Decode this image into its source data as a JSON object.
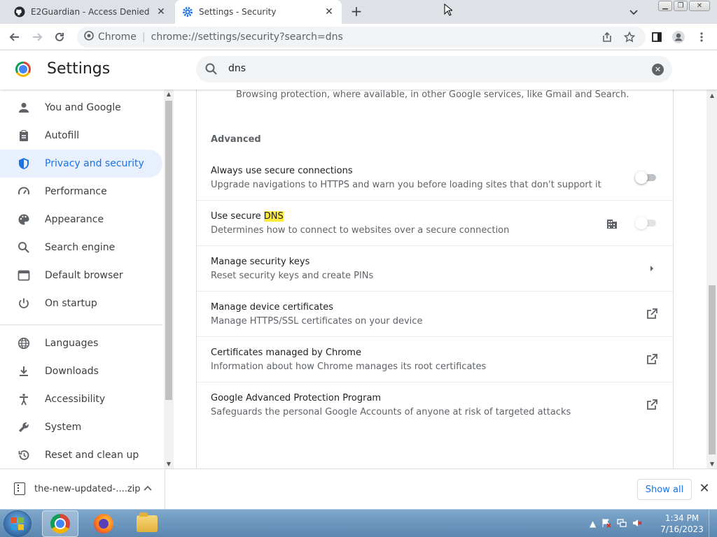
{
  "tabs": [
    {
      "title": "E2Guardian - Access Denied",
      "icon": "github-icon",
      "active": false
    },
    {
      "title": "Settings - Security",
      "icon": "gear-icon",
      "active": true
    }
  ],
  "toolbar": {
    "site_label": "Chrome",
    "url": "chrome://settings/security?search=dns"
  },
  "settings": {
    "title": "Settings",
    "search_value": "dns",
    "search_placeholder": "Search settings"
  },
  "sidebar": {
    "items": [
      {
        "label": "You and Google",
        "icon": "person-icon"
      },
      {
        "label": "Autofill",
        "icon": "clipboard-icon"
      },
      {
        "label": "Privacy and security",
        "icon": "shield-icon",
        "active": true
      },
      {
        "label": "Performance",
        "icon": "speedometer-icon"
      },
      {
        "label": "Appearance",
        "icon": "palette-icon"
      },
      {
        "label": "Search engine",
        "icon": "search-icon"
      },
      {
        "label": "Default browser",
        "icon": "browser-icon"
      },
      {
        "label": "On startup",
        "icon": "power-icon"
      },
      {
        "label": "Languages",
        "icon": "globe-icon"
      },
      {
        "label": "Downloads",
        "icon": "download-icon"
      },
      {
        "label": "Accessibility",
        "icon": "accessibility-icon"
      },
      {
        "label": "System",
        "icon": "wrench-icon"
      },
      {
        "label": "Reset and clean up",
        "icon": "restore-icon"
      }
    ]
  },
  "main": {
    "note": "Browsing protection, where available, in other Google services, like Gmail and Search.",
    "section_heading": "Advanced",
    "rows": [
      {
        "title": "Always use secure connections",
        "subtitle": "Upgrade navigations to HTTPS and warn you before loading sites that don't support it",
        "control": "toggle",
        "on": false
      },
      {
        "title_prefix": "Use secure ",
        "title_highlight": "DNS",
        "subtitle": "Determines how to connect to websites over a secure connection",
        "control": "toggle-managed",
        "on": false
      },
      {
        "title": "Manage security keys",
        "subtitle": "Reset security keys and create PINs",
        "control": "chevron"
      },
      {
        "title": "Manage device certificates",
        "subtitle": "Manage HTTPS/SSL certificates on your device",
        "control": "external-link"
      },
      {
        "title": "Certificates managed by Chrome",
        "subtitle": "Information about how Chrome manages its root certificates",
        "control": "external-link"
      },
      {
        "title": "Google Advanced Protection Program",
        "subtitle": "Safeguards the personal Google Accounts of anyone at risk of targeted attacks",
        "control": "external-link"
      }
    ]
  },
  "download_bar": {
    "file_name": "the-new-updated-....zip",
    "show_all_label": "Show all"
  },
  "taskbar": {
    "time": "1:34 PM",
    "date": "7/16/2023"
  },
  "colors": {
    "accent": "#1a73e8",
    "active_bg": "#e8f0fe",
    "highlight": "#ffeb3b",
    "taskbar": "#6a96c0"
  }
}
